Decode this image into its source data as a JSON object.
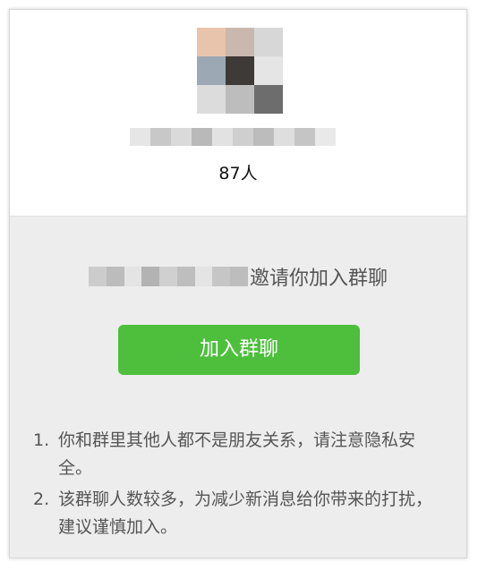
{
  "group": {
    "member_count": "87人",
    "avatar_pixels": [
      "#e8c4ad",
      "#c9b8ad",
      "#d7d7d7",
      "#9ca9b5",
      "#3e3a38",
      "#e5e5e5",
      "#dcdcdc",
      "#bdbdbd",
      "#6d6d6d"
    ],
    "name_blur": [
      "#e6e6e6",
      "#c8c8c8",
      "#dadada",
      "#b9b9b9",
      "#e2e2e2",
      "#cfcfcf",
      "#bcbcbc",
      "#dedede",
      "#c5c5c5",
      "#e9e9e9"
    ]
  },
  "invite": {
    "inviter_blur": [
      "#cccccc",
      "#bcbcbc",
      "#e4e4e4",
      "#b3b3b3",
      "#d0d0d0",
      "#bebebe",
      "#e4e4e4",
      "#c6c6c6",
      "#bdbdbd"
    ],
    "text": "邀请你加入群聊"
  },
  "join_button": {
    "label": "加入群聊",
    "color": "#4dbf3c"
  },
  "notes": [
    {
      "num": "1.",
      "text": "你和群里其他人都不是朋友关系，请注意隐私安全。"
    },
    {
      "num": "2.",
      "text": "该群聊人数较多，为减少新消息给你带来的打扰，建议谨慎加入。"
    }
  ]
}
